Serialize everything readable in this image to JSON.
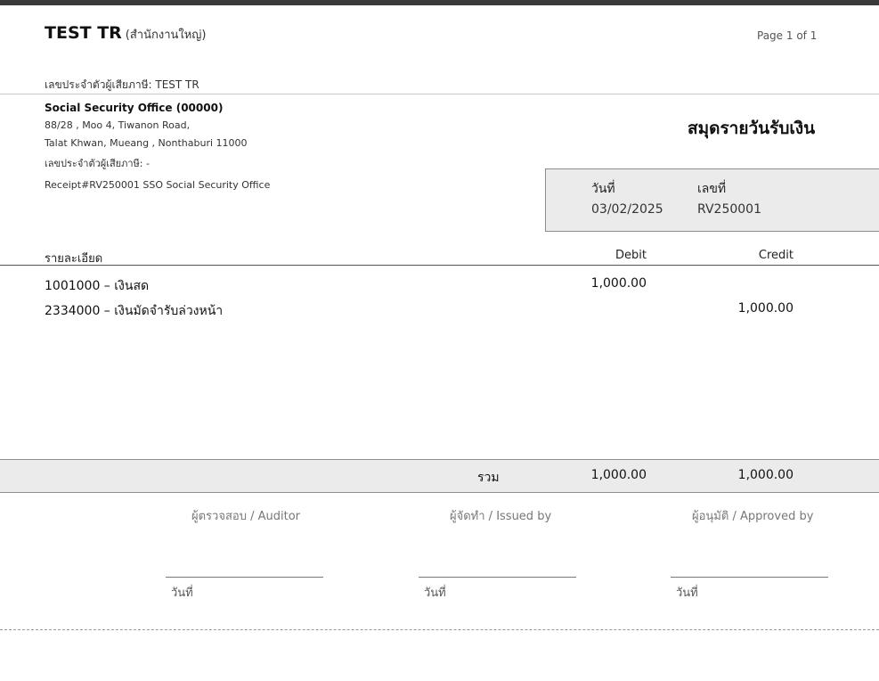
{
  "header": {
    "company_name": "TEST TR",
    "branch": "(สำนักงานใหญ่)",
    "page_label": "Page 1 of 1",
    "tax_id_line": "เลขประจำตัวผู้เสียภาษี: TEST TR"
  },
  "customer": {
    "name": "Social Security Office (00000)",
    "address_line1": "88/28 , Moo 4, Tiwanon Road,",
    "address_line2": "Talat Khwan, Mueang , Nonthaburi 11000",
    "tax_id_line": "เลขประจำตัวผู้เสียภาษี: -",
    "reference": "Receipt#RV250001 SSO Social Security Office"
  },
  "document": {
    "title": "สมุดรายวันรับเงิน",
    "date_label": "วันที่",
    "date_value": "03/02/2025",
    "number_label": "เลขที่",
    "number_value": "RV250001"
  },
  "table": {
    "col_detail": "รายละเอียด",
    "col_debit": "Debit",
    "col_credit": "Credit",
    "rows": [
      {
        "account": "1001000 – เงินสด",
        "debit": "1,000.00",
        "credit": ""
      },
      {
        "account": "2334000 – เงินมัดจำรับล่วงหน้า",
        "debit": "",
        "credit": "1,000.00"
      }
    ],
    "total_label": "รวม",
    "total_debit": "1,000.00",
    "total_credit": "1,000.00"
  },
  "signatures": {
    "auditor": "ผู้ตรวจสอบ / Auditor",
    "issued_by": "ผู้จัดทำ / Issued by",
    "approved_by": "ผู้อนุมัติ / Approved by",
    "date_label": "วันที่"
  }
}
